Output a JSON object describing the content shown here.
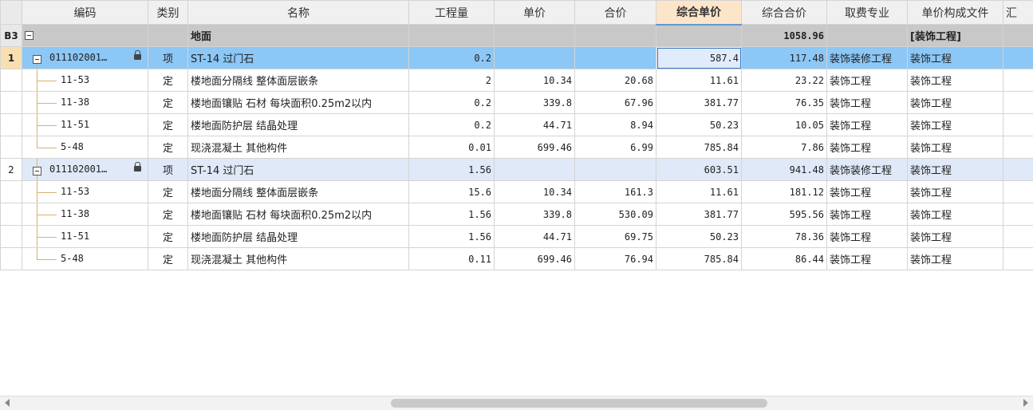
{
  "columns": {
    "code": "编码",
    "type": "类别",
    "name": "名称",
    "qty": "工程量",
    "price": "单价",
    "total": "合价",
    "unit_comp": "综合单价",
    "comp_total": "综合合价",
    "fee_spec": "取费专业",
    "price_file": "单价构成文件",
    "summary": "汇"
  },
  "section": {
    "id": "B3",
    "name": "地面",
    "comp_total": "1058.96",
    "price_file": "[装饰工程]"
  },
  "rows": [
    {
      "rn": "1",
      "code": "011102001…",
      "type": "项",
      "name": "ST-14 过门石",
      "qty": "0.2",
      "price": "",
      "total": "",
      "unit_comp": "587.4",
      "comp_total": "117.48",
      "fee_spec": "装饰装修工程",
      "price_file": "装饰工程"
    },
    {
      "rn": "",
      "code": "11-53",
      "type": "定",
      "name": "楼地面分隔线 整体面层嵌条",
      "qty": "2",
      "price": "10.34",
      "total": "20.68",
      "unit_comp": "11.61",
      "comp_total": "23.22",
      "fee_spec": "装饰工程",
      "price_file": "装饰工程"
    },
    {
      "rn": "",
      "code": "11-38",
      "type": "定",
      "name": "楼地面镶贴 石材 每块面积0.25m2以内",
      "qty": "0.2",
      "price": "339.8",
      "total": "67.96",
      "unit_comp": "381.77",
      "comp_total": "76.35",
      "fee_spec": "装饰工程",
      "price_file": "装饰工程"
    },
    {
      "rn": "",
      "code": "11-51",
      "type": "定",
      "name": "楼地面防护层 结晶处理",
      "qty": "0.2",
      "price": "44.71",
      "total": "8.94",
      "unit_comp": "50.23",
      "comp_total": "10.05",
      "fee_spec": "装饰工程",
      "price_file": "装饰工程"
    },
    {
      "rn": "",
      "code": "5-48",
      "type": "定",
      "name": "现浇混凝土 其他构件",
      "qty": "0.01",
      "price": "699.46",
      "total": "6.99",
      "unit_comp": "785.84",
      "comp_total": "7.86",
      "fee_spec": "装饰工程",
      "price_file": "装饰工程"
    },
    {
      "rn": "2",
      "code": "011102001…",
      "type": "项",
      "name": "ST-14 过门石",
      "qty": "1.56",
      "price": "",
      "total": "",
      "unit_comp": "603.51",
      "comp_total": "941.48",
      "fee_spec": "装饰装修工程",
      "price_file": "装饰工程"
    },
    {
      "rn": "",
      "code": "11-53",
      "type": "定",
      "name": "楼地面分隔线 整体面层嵌条",
      "qty": "15.6",
      "price": "10.34",
      "total": "161.3",
      "unit_comp": "11.61",
      "comp_total": "181.12",
      "fee_spec": "装饰工程",
      "price_file": "装饰工程"
    },
    {
      "rn": "",
      "code": "11-38",
      "type": "定",
      "name": "楼地面镶贴 石材 每块面积0.25m2以内",
      "qty": "1.56",
      "price": "339.8",
      "total": "530.09",
      "unit_comp": "381.77",
      "comp_total": "595.56",
      "fee_spec": "装饰工程",
      "price_file": "装饰工程"
    },
    {
      "rn": "",
      "code": "11-51",
      "type": "定",
      "name": "楼地面防护层 结晶处理",
      "qty": "1.56",
      "price": "44.71",
      "total": "69.75",
      "unit_comp": "50.23",
      "comp_total": "78.36",
      "fee_spec": "装饰工程",
      "price_file": "装饰工程"
    },
    {
      "rn": "",
      "code": "5-48",
      "type": "定",
      "name": "现浇混凝土 其他构件",
      "qty": "0.11",
      "price": "699.46",
      "total": "76.94",
      "unit_comp": "785.84",
      "comp_total": "86.44",
      "fee_spec": "装饰工程",
      "price_file": "装饰工程"
    }
  ]
}
